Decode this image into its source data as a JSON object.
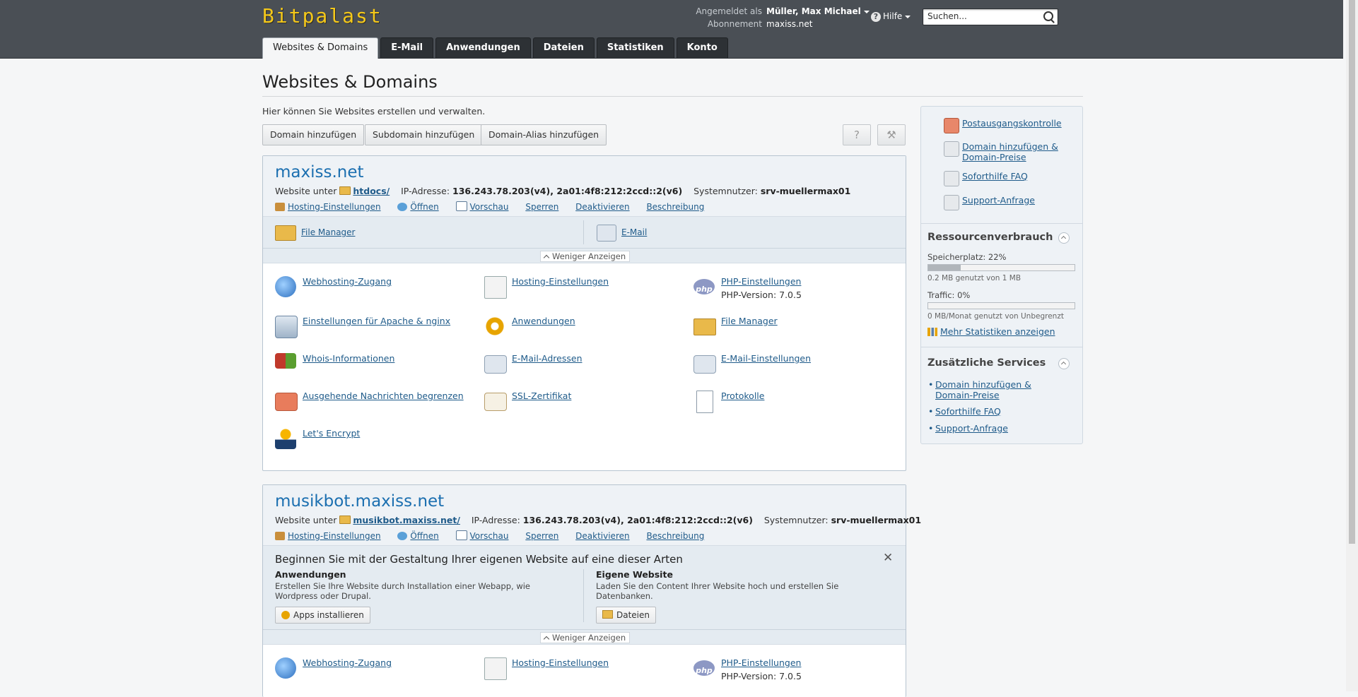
{
  "header": {
    "logo": "Bitpalast",
    "logged_in_label": "Angemeldet als",
    "logged_in_user": "Müller, Max Michael",
    "subscription_label": "Abonnement",
    "subscription_value": "maxiss.net",
    "help_label": "Hilfe",
    "search_placeholder": "Suchen..."
  },
  "tabs": [
    "Websites & Domains",
    "E-Mail",
    "Anwendungen",
    "Dateien",
    "Statistiken",
    "Konto"
  ],
  "page": {
    "title": "Websites & Domains",
    "intro": "Hier können Sie Websites erstellen und verwalten.",
    "buttons": [
      "Domain hinzufügen",
      "Subdomain hinzufügen",
      "Domain-Alias hinzufügen"
    ],
    "help_btn": "?"
  },
  "domains": [
    {
      "name": "maxiss.net",
      "website_label": "Website unter",
      "docroot": "htdocs/",
      "ip_label": "IP-Adresse:",
      "ip": "136.243.78.203(v4), 2a01:4f8:212:2ccd::2(v6)",
      "sysuser_label": "Systemnutzer:",
      "sysuser": "srv-muellermax01",
      "actions": [
        "Hosting-Einstellungen",
        "Öffnen",
        "Vorschau",
        "Sperren",
        "Deaktivieren",
        "Beschreibung"
      ],
      "quick": [
        "File Manager",
        "E-Mail"
      ],
      "toggle": "Weniger Anzeigen",
      "tools": [
        {
          "label": "Webhosting-Zugang",
          "icon": "globe-icon"
        },
        {
          "label": "Hosting-Einstellungen",
          "icon": "document-icon"
        },
        {
          "label": "PHP-Einstellungen",
          "sub": "PHP-Version: 7.0.5",
          "icon": "php-icon"
        },
        {
          "label": "Einstellungen für Apache & nginx",
          "icon": "server-icon"
        },
        {
          "label": "Anwendungen",
          "icon": "gear-icon"
        },
        {
          "label": "File Manager",
          "icon": "folder-icon"
        },
        {
          "label": "Whois-Informationen",
          "icon": "flags-icon"
        },
        {
          "label": "E-Mail-Adressen",
          "icon": "mail-icon"
        },
        {
          "label": "E-Mail-Einstellungen",
          "icon": "mail-settings-icon"
        },
        {
          "label": "Ausgehende Nachrichten begrenzen",
          "icon": "mail-limit-icon"
        },
        {
          "label": "SSL-Zertifikat",
          "icon": "certificate-icon"
        },
        {
          "label": "Protokolle",
          "icon": "log-icon"
        },
        {
          "label": "Let's Encrypt",
          "icon": "lets-encrypt-icon"
        }
      ]
    },
    {
      "name": "musikbot.maxiss.net",
      "website_label": "Website unter",
      "docroot": "musikbot.maxiss.net/",
      "ip_label": "IP-Adresse:",
      "ip": "136.243.78.203(v4), 2a01:4f8:212:2ccd::2(v6)",
      "sysuser_label": "Systemnutzer:",
      "sysuser": "srv-muellermax01",
      "actions": [
        "Hosting-Einstellungen",
        "Öffnen",
        "Vorschau",
        "Sperren",
        "Deaktivieren",
        "Beschreibung"
      ],
      "welcome": {
        "title": "Beginnen Sie mit der Gestaltung Ihrer eigenen Website auf eine dieser Arten",
        "apps_title": "Anwendungen",
        "apps_text": "Erstellen Sie Ihre Website durch Installation einer Webapp, wie Wordpress oder Drupal.",
        "apps_button": "Apps installieren",
        "own_title": "Eigene Website",
        "own_text": "Laden Sie den Content Ihrer Website hoch und erstellen Sie Datenbanken.",
        "own_button": "Dateien"
      },
      "toggle": "Weniger Anzeigen",
      "tools": [
        {
          "label": "Webhosting-Zugang",
          "icon": "globe-icon"
        },
        {
          "label": "Hosting-Einstellungen",
          "icon": "document-icon"
        },
        {
          "label": "PHP-Einstellungen",
          "sub": "PHP-Version: 7.0.5",
          "icon": "php-icon"
        }
      ]
    }
  ],
  "sidebar": {
    "links": [
      "Postausgangskontrolle",
      "Domain hinzufügen & Domain-Preise",
      "Soforthilfe FAQ",
      "Support-Anfrage"
    ],
    "resources_title": "Ressourcenverbrauch",
    "storage_label": "Speicherplatz: 22%",
    "storage_fraction": 0.22,
    "storage_sub": "0.2 MB genutzt von 1 MB",
    "traffic_label": "Traffic: 0%",
    "traffic_fraction": 0,
    "traffic_sub": "0 MB/Monat genutzt von Unbegrenzt",
    "more_stats": "Mehr Statistiken anzeigen",
    "services_title": "Zusätzliche Services",
    "services": [
      "Domain hinzufügen & Domain-Preise",
      "Soforthilfe FAQ",
      "Support-Anfrage"
    ]
  },
  "colors": {
    "header_bg": "#4a4f55",
    "logo": "#f4c81a",
    "link": "#1f5b8a",
    "domain_title": "#1b6fb0"
  }
}
